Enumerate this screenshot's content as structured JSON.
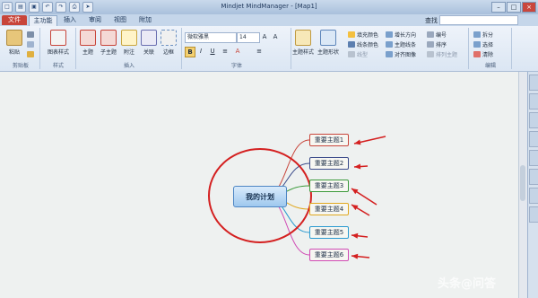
{
  "window": {
    "title": "Mindjet MindManager - [Map1]",
    "quick_access_icons": [
      "new-icon",
      "open-icon",
      "save-icon",
      "undo-icon",
      "redo-icon",
      "print-icon",
      "send-icon"
    ]
  },
  "ribbon_tabs": [
    "文件",
    "主功能",
    "插入",
    "审阅",
    "视图",
    "附加"
  ],
  "search": {
    "label": "查找"
  },
  "ribbon": {
    "clipboard": {
      "label": "剪贴板",
      "paste": "粘贴"
    },
    "style": {
      "label": "样式",
      "map_style": "图表样式"
    },
    "insert": {
      "label": "插入",
      "main_topic": "主题",
      "subtopic": "子主题",
      "callout": "附注",
      "relationship": "关联",
      "boundary": "边框"
    },
    "font": {
      "label": "字体",
      "family": "微软雅黑",
      "size": "14"
    },
    "format": {
      "topic_style": "主题样式",
      "topic_shape": "主题形状",
      "fill_color": "填充颜色",
      "line_color": "线条颜色",
      "line": "线型",
      "grow_direction": "增长方向",
      "expand_lines": "主题线条",
      "align_image": "对齐图像",
      "numbering": "编号",
      "sort": "排序",
      "arrange": "排列主题"
    },
    "edit": {
      "label": "编辑",
      "split": "拆分",
      "select": "选择",
      "clear": "清除"
    }
  },
  "map": {
    "central_topic": "我的计划",
    "topics": [
      "重要主题1",
      "重要主题2",
      "重要主题3",
      "重要主题4",
      "重要主题5",
      "重要主题6"
    ],
    "branch_colors": [
      "#c8463c",
      "#3a4a8a",
      "#3c9a3c",
      "#e0a820",
      "#2a9ad0",
      "#d04ab4"
    ],
    "annotation_color": "#d42020"
  },
  "watermark": "头条@问答"
}
